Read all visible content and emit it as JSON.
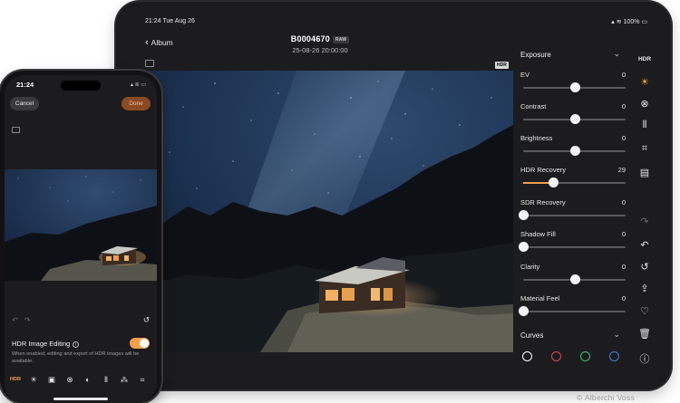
{
  "ipad": {
    "status": {
      "time": "21:24  Tue Aug 26",
      "right": "100%"
    },
    "nav": {
      "back_label": "Album",
      "title": "B0004670",
      "raw_badge": "RAW",
      "date": "25-08-26 20:00:00",
      "hdr_badge": "HDR"
    },
    "panel": {
      "exposure_header": "Exposure",
      "adjustments": [
        {
          "label": "EV",
          "value": "0",
          "level": 0.5
        },
        {
          "label": "Contrast",
          "value": "0",
          "level": 0.5
        },
        {
          "label": "Brightness",
          "value": "0",
          "level": 0.5
        },
        {
          "label": "HDR Recovery",
          "value": "29",
          "level": 0.29
        },
        {
          "label": "SDR Recovery",
          "value": "0",
          "level": 0.0
        },
        {
          "label": "Shadow Fill",
          "value": "0",
          "level": 0.0
        },
        {
          "label": "Clarity",
          "value": "0",
          "level": 0.5
        },
        {
          "label": "Material Feel",
          "value": "0",
          "level": 0.0
        }
      ],
      "curves_header": "Curves",
      "curve_channels": [
        {
          "name": "rgb",
          "color": "#ffffff"
        },
        {
          "name": "red",
          "color": "#e0455a"
        },
        {
          "name": "green",
          "color": "#3fbf6f"
        },
        {
          "name": "blue",
          "color": "#3f7fe0"
        }
      ]
    },
    "rail": {
      "hdr_label": "HDR",
      "accent": "#f2a04b"
    }
  },
  "iphone": {
    "time": "21:24",
    "cancel_label": "Cancel",
    "done_label": "Done",
    "hdr_toggle_label": "HDR Image Editing",
    "hdr_toggle_on": true,
    "hdr_desc": "When enabled, editing and export of HDR images will be available.",
    "toolbar_hdr_label": "HDR"
  },
  "credit": "© Alberchi Voss"
}
